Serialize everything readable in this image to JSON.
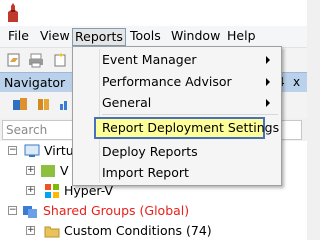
{
  "menubar": {
    "items": [
      "File",
      "View",
      "Reports",
      "Tools",
      "Window",
      "Help"
    ]
  },
  "navigator": {
    "title": "Navigator",
    "pin_label": "4",
    "close_label": "x"
  },
  "search": {
    "placeholder": "Search"
  },
  "tree": {
    "rows": [
      {
        "label": "Virtu",
        "color": "#000000"
      },
      {
        "label": "V",
        "color": "#000000"
      },
      {
        "label": "Hyper-V",
        "color": "#000000"
      },
      {
        "label": "Shared Groups (Global)",
        "color": "#e8211b"
      },
      {
        "label": "Custom Conditions (74)",
        "color": "#000000"
      }
    ]
  },
  "reports_menu": {
    "items": [
      {
        "label": "Event Manager"
      },
      {
        "label": "Performance Advisor"
      },
      {
        "label": "General"
      },
      {
        "label": "Report Deployment Settings"
      },
      {
        "label": "Deploy Reports"
      },
      {
        "label": "Import Report"
      }
    ]
  },
  "colors": {
    "highlight_fill": "#ffff99",
    "highlight_border": "#4a6fbf",
    "navigator_header": "#b9d1ea"
  }
}
